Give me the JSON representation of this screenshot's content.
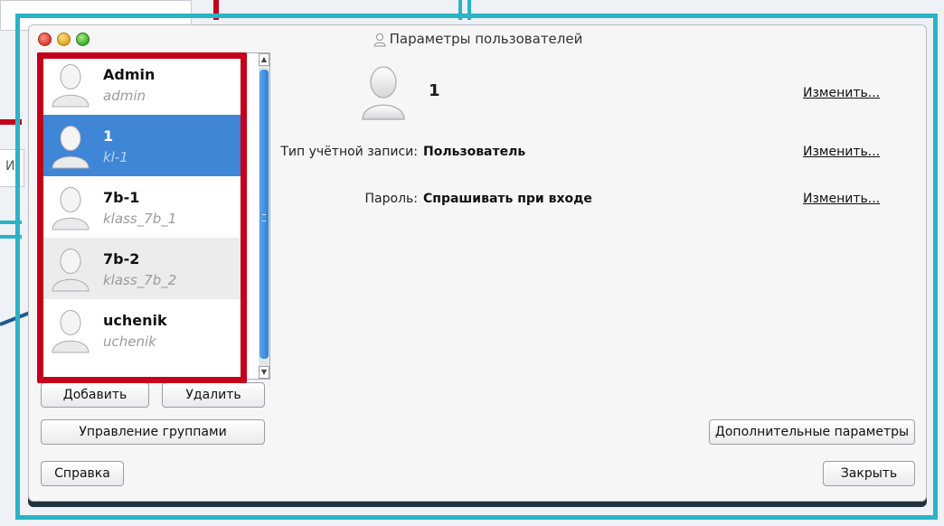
{
  "window": {
    "title": "Параметры пользователей"
  },
  "background": {
    "fragment_text": "И"
  },
  "users": [
    {
      "name": "Admin",
      "login": "admin"
    },
    {
      "name": "1",
      "login": "kl-1"
    },
    {
      "name": "7b-1",
      "login": "klass_7b_1"
    },
    {
      "name": "7b-2",
      "login": "klass_7b_2"
    },
    {
      "name": "uchenik",
      "login": "uchenik"
    }
  ],
  "selected_user_index": 1,
  "details": {
    "name": "1",
    "account_type_label": "Тип учётной записи:",
    "account_type_value": "Пользователь",
    "password_label": "Пароль:",
    "password_value": "Спрашивать при входе"
  },
  "links": {
    "change": "Изменить..."
  },
  "buttons": {
    "add": "Добавить",
    "delete": "Удалить",
    "groups": "Управление группами",
    "help": "Справка",
    "advanced": "Дополнительные параметры",
    "close": "Закрыть"
  },
  "colors": {
    "highlight_red": "#c4001a",
    "frame_teal": "#2ab3c7",
    "selection_blue": "#3f86d6"
  }
}
